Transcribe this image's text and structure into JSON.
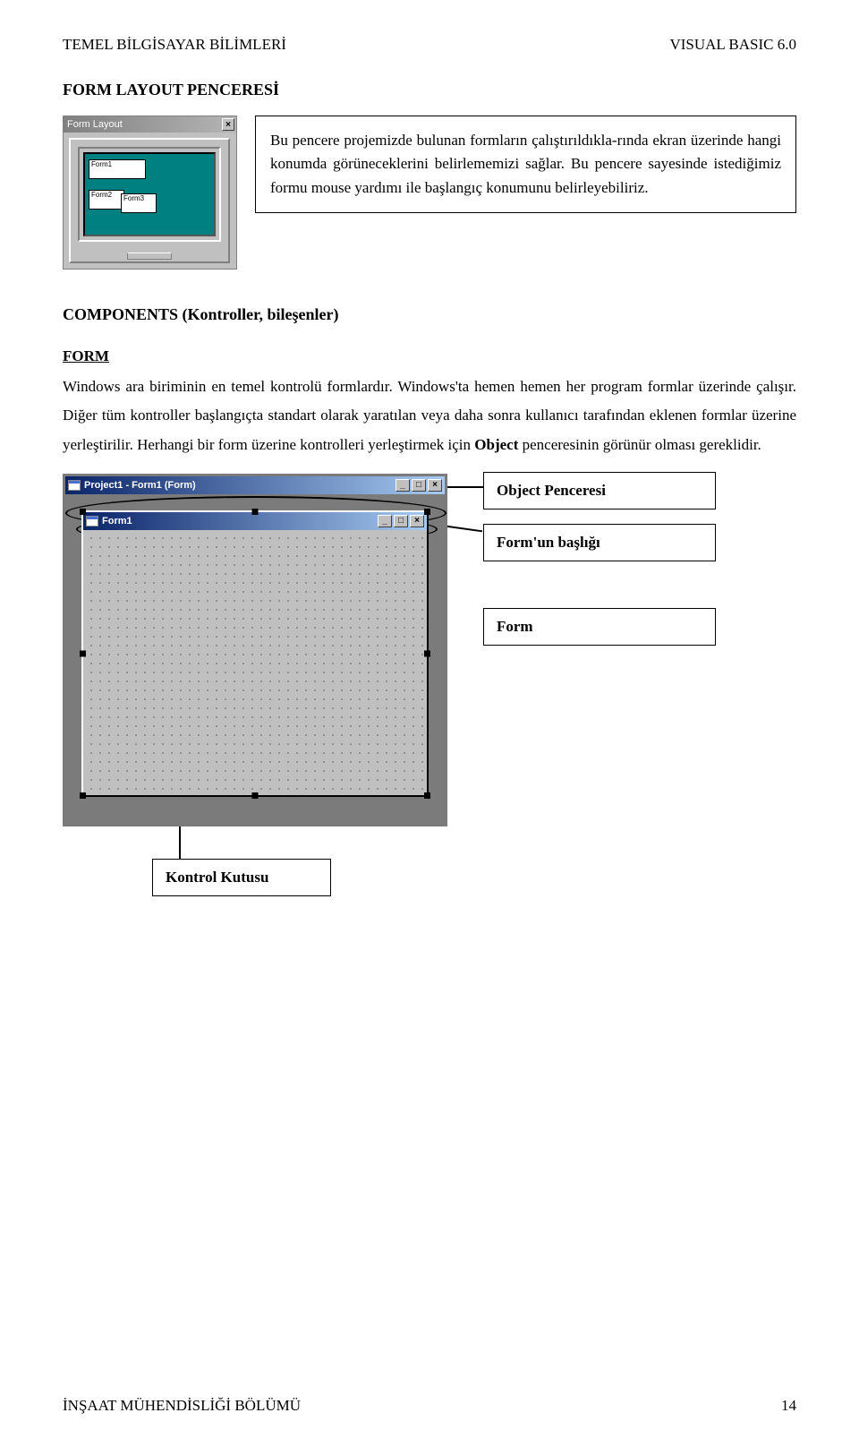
{
  "header": {
    "left": "TEMEL BİLGİSAYAR BİLİMLERİ",
    "right": "VISUAL BASIC 6.0"
  },
  "sections": {
    "form_layout_title": "FORM LAYOUT PENCERESİ",
    "form_layout_window": {
      "title": "Form Layout",
      "forms": {
        "f1": "Form1",
        "f2": "Form2",
        "f3": "Form3"
      },
      "close_glyph": "×"
    },
    "form_layout_text": "Bu pencere projemizde bulunan formların çalıştırıldıkla-rında ekran üzerinde hangi konumda görüneceklerini belirlememizi sağlar. Bu pencere sayesinde istediğimiz formu mouse yardımı ile başlangıç konumunu belirleyebiliriz.",
    "components_title": "COMPONENTS (Kontroller, bileşenler)",
    "form_heading": "FORM",
    "body_p1": "Windows ara biriminin en temel kontrolü formlardır. Windows'ta hemen hemen her program formlar üzerinde çalışır. Diğer tüm kontroller başlangıçta standart olarak yaratılan veya daha sonra kullanıcı tarafından eklenen formlar üzerine yerleştirilir. Herhangi bir form üzerine kontrolleri yerleştirmek için ",
    "body_obj": "Object",
    "body_p2": " penceresinin görünür olması gereklidir."
  },
  "object_window": {
    "outer_title": "Project1 - Form1 (Form)",
    "inner_title": "Form1",
    "min_glyph": "_",
    "max_glyph": "□",
    "close_glyph": "×"
  },
  "callouts": {
    "object_penceresi": "Object Penceresi",
    "form_basligi": "Form'un başlığı",
    "form": "Form",
    "kontrol_kutusu": "Kontrol Kutusu"
  },
  "footer": {
    "left": "İNŞAAT MÜHENDİSLİĞİ BÖLÜMÜ",
    "right": "14"
  }
}
